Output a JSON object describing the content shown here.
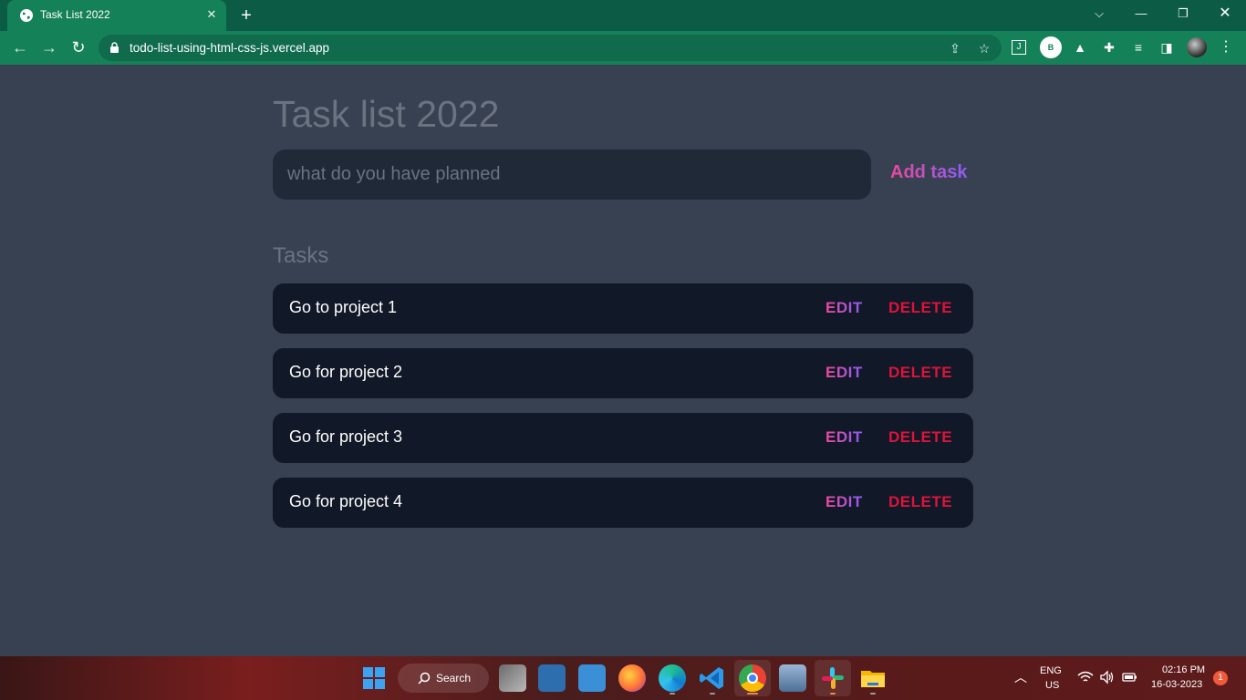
{
  "browser": {
    "tab_title": "Task List 2022",
    "url": "todo-list-using-html-css-js.vercel.app",
    "profile_letter": "B"
  },
  "app": {
    "title": "Task list 2022",
    "input_placeholder": "what do you have planned",
    "add_button": "Add task",
    "tasks_heading": "Tasks",
    "tasks": [
      {
        "text": "Go to project 1",
        "edit": "EDIT",
        "delete": "DELETE"
      },
      {
        "text": "Go for project 2",
        "edit": "EDIT",
        "delete": "DELETE"
      },
      {
        "text": "Go for project 3",
        "edit": "EDIT",
        "delete": "DELETE"
      },
      {
        "text": "Go for project 4",
        "edit": "EDIT",
        "delete": "DELETE"
      }
    ]
  },
  "taskbar": {
    "search_label": "Search",
    "lang_line1": "ENG",
    "lang_line2": "US",
    "time": "02:16 PM",
    "date": "16-03-2023",
    "notification_count": "1"
  },
  "colors": {
    "page_bg": "#374151",
    "input_bg": "#1f2937",
    "task_bg": "#111827",
    "accent_pink": "#ec4899",
    "accent_purple": "#8b5cf6",
    "delete_red": "#dc143c",
    "chrome_green": "#158158"
  }
}
